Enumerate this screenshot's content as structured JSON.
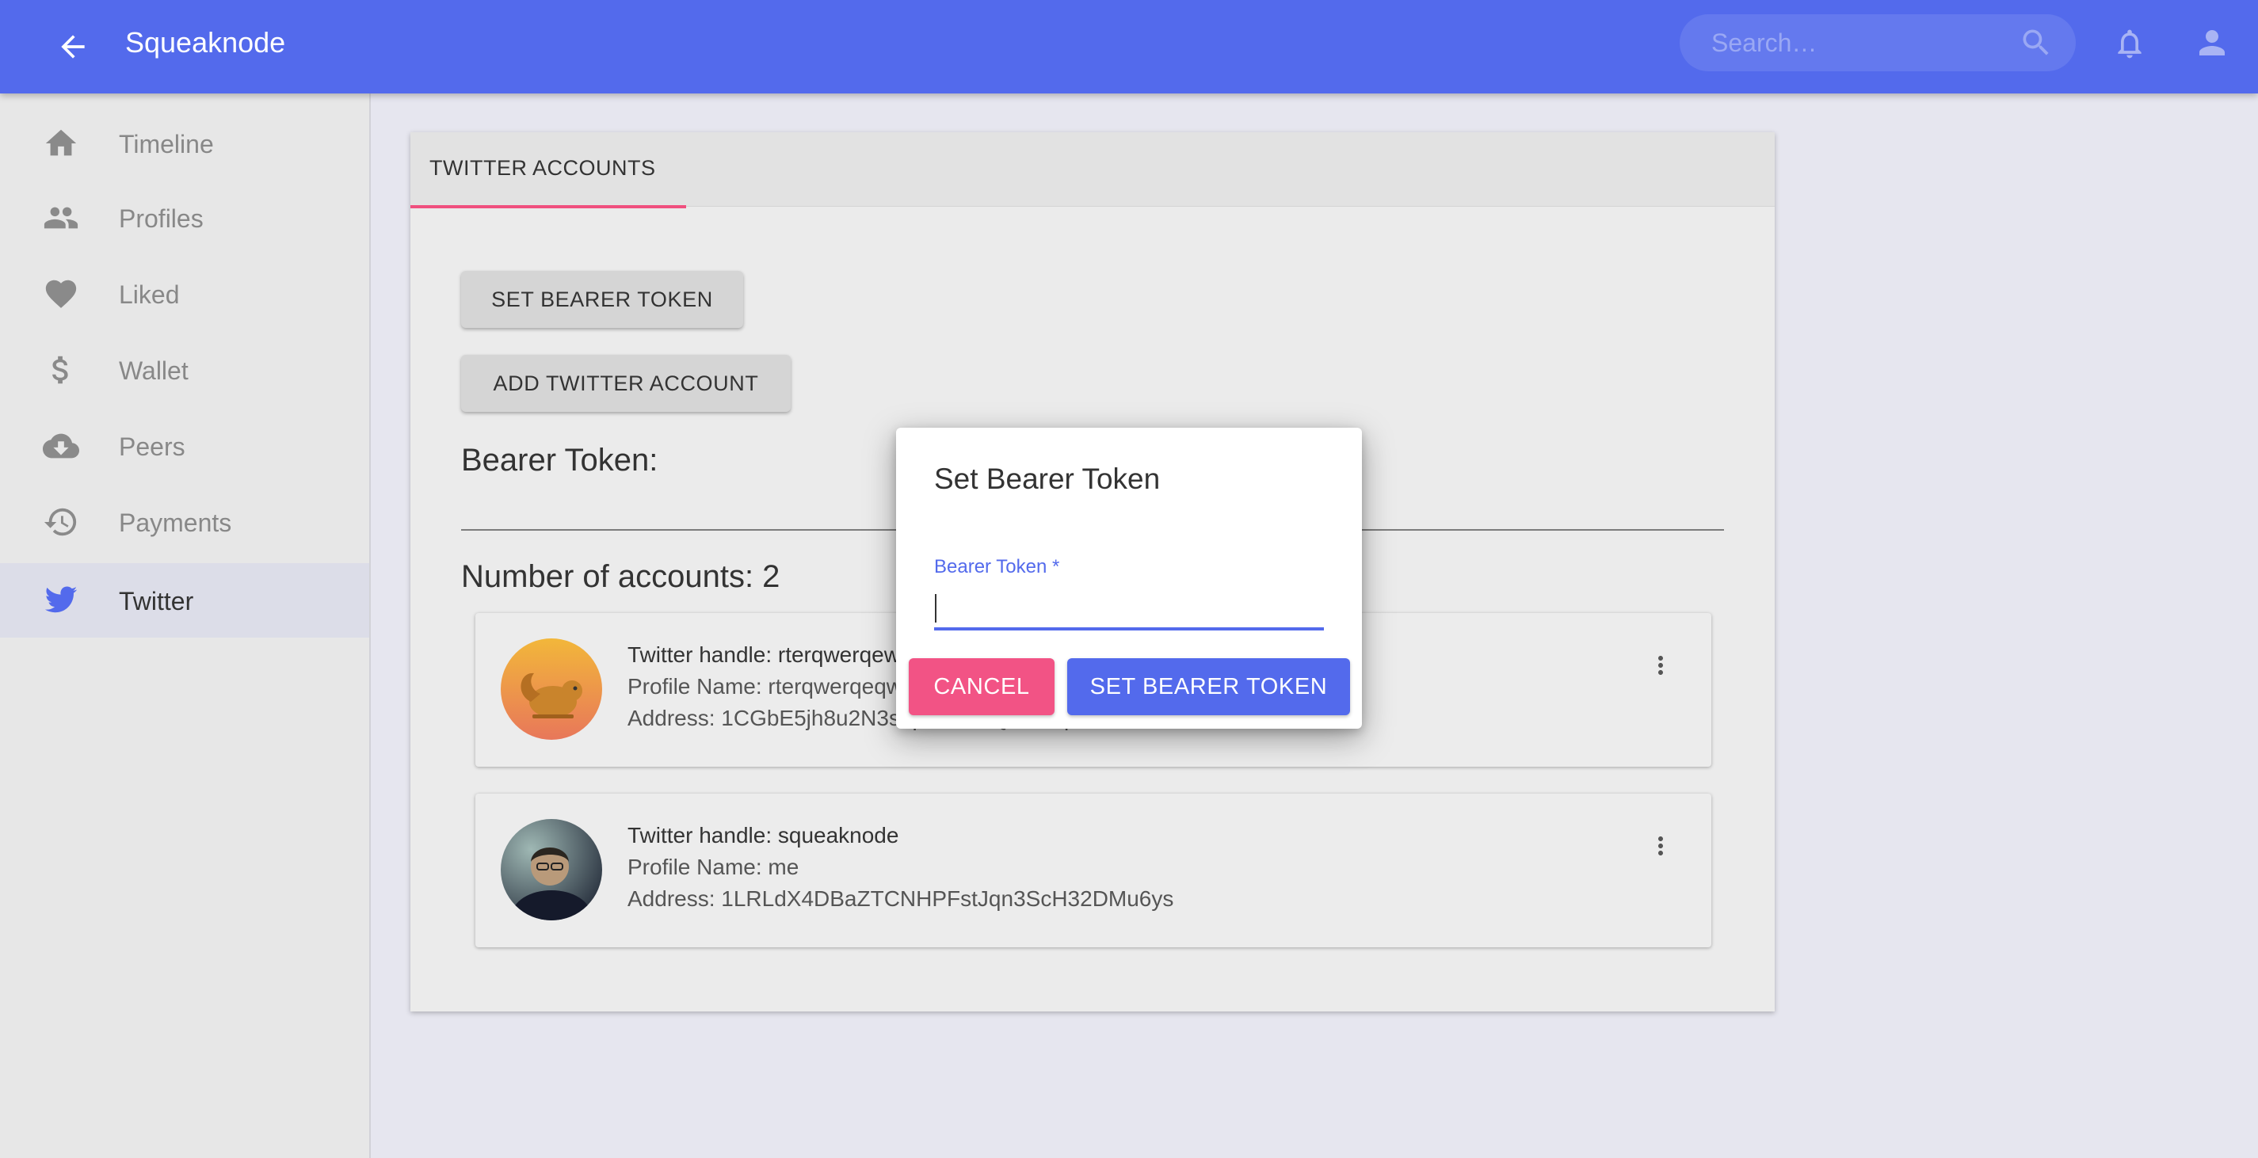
{
  "appbar": {
    "title": "Squeaknode",
    "search_placeholder": "Search…",
    "color": "#536aec"
  },
  "sidebar": {
    "items": [
      {
        "label": "Timeline",
        "icon": "home-icon"
      },
      {
        "label": "Profiles",
        "icon": "people-icon"
      },
      {
        "label": "Liked",
        "icon": "heart-icon"
      },
      {
        "label": "Wallet",
        "icon": "dollar-icon"
      },
      {
        "label": "Peers",
        "icon": "cloud-download-icon"
      },
      {
        "label": "Payments",
        "icon": "history-icon"
      },
      {
        "label": "Twitter",
        "icon": "twitter-icon",
        "active": true
      }
    ]
  },
  "main": {
    "tab_label": "TWITTER ACCOUNTS",
    "set_bearer_button": "SET BEARER TOKEN",
    "add_account_button": "ADD TWITTER ACCOUNT",
    "bearer_label": "Bearer Token:",
    "accounts_count_label": "Number of accounts: 2",
    "accounts": [
      {
        "handle_line": "Twitter handle: rterqwerqewrqwer",
        "profile_line": "Profile Name: rterqwerqeqwer",
        "address_line": "Address: 1CGbE5jh8u2N3sepGKtRaQhEbwpAoC9hC",
        "avatar": "squirrel-avatar"
      },
      {
        "handle_line": "Twitter handle: squeaknode",
        "profile_line": "Profile Name: me",
        "address_line": "Address: 1LRLdX4DBaZTCNHPFstJqn3ScH32DMu6ys",
        "avatar": "person-avatar"
      }
    ]
  },
  "dialog": {
    "title": "Set Bearer Token",
    "field_label": "Bearer Token *",
    "field_value": "",
    "cancel_label": "CANCEL",
    "submit_label": "SET BEARER TOKEN",
    "accent": "#536aec",
    "cancel_color": "#f25385"
  }
}
